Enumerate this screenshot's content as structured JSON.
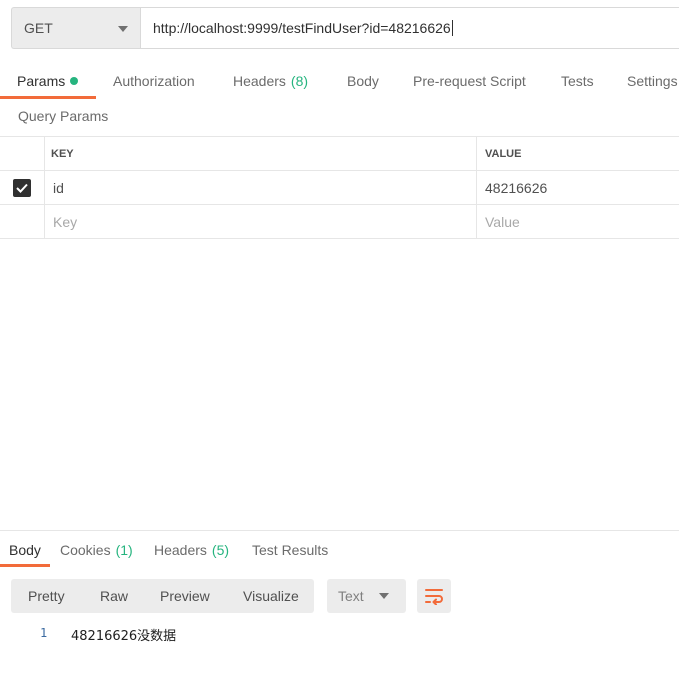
{
  "request": {
    "method": "GET",
    "url": "http://localhost:9999/testFindUser?id=48216626"
  },
  "request_tabs": {
    "params": "Params",
    "authorization": "Authorization",
    "headers": "Headers",
    "headers_count": "(8)",
    "body": "Body",
    "pre_request_script": "Pre-request Script",
    "tests": "Tests",
    "settings": "Settings"
  },
  "query_params": {
    "title": "Query Params",
    "columns": {
      "key": "KEY",
      "value": "VALUE"
    },
    "rows": [
      {
        "checked": true,
        "key": "id",
        "value": "48216626"
      }
    ],
    "placeholder": {
      "key": "Key",
      "value": "Value"
    }
  },
  "response_tabs": {
    "body": "Body",
    "cookies": "Cookies",
    "cookies_count": "(1)",
    "headers": "Headers",
    "headers_count": "(5)",
    "test_results": "Test Results"
  },
  "response_view": {
    "pretty": "Pretty",
    "raw": "Raw",
    "preview": "Preview",
    "visualize": "Visualize",
    "format": "Text"
  },
  "response_body": {
    "line_number": "1",
    "text": "48216626没数据"
  },
  "colors": {
    "accent": "#f26b3a",
    "success": "#26b47f"
  },
  "icons": {
    "method_dropdown": "chevron-down-icon",
    "wrap": "wrap-lines-icon",
    "checkbox": "check-icon"
  }
}
